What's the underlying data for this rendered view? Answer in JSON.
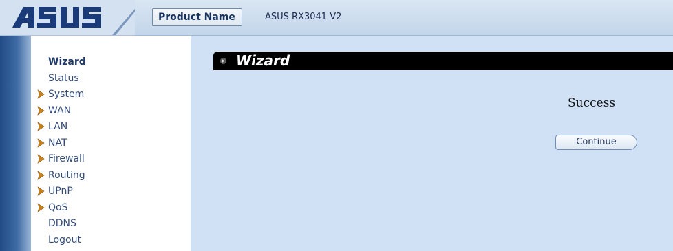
{
  "header": {
    "logo_text": "ASUS",
    "product_label": "Product Name",
    "product_value": "ASUS RX3041 V2"
  },
  "sidebar": {
    "items": [
      {
        "label": "Wizard",
        "active": true,
        "expandable": false
      },
      {
        "label": "Status",
        "active": false,
        "expandable": false
      },
      {
        "label": "System",
        "active": false,
        "expandable": true
      },
      {
        "label": "WAN",
        "active": false,
        "expandable": true
      },
      {
        "label": "LAN",
        "active": false,
        "expandable": true
      },
      {
        "label": "NAT",
        "active": false,
        "expandable": true
      },
      {
        "label": "Firewall",
        "active": false,
        "expandable": true
      },
      {
        "label": "Routing",
        "active": false,
        "expandable": true
      },
      {
        "label": "UPnP",
        "active": false,
        "expandable": true
      },
      {
        "label": "QoS",
        "active": false,
        "expandable": true
      },
      {
        "label": "DDNS",
        "active": false,
        "expandable": false
      },
      {
        "label": "Logout",
        "active": false,
        "expandable": false
      }
    ]
  },
  "main": {
    "title": "Wizard",
    "status_message": "Success",
    "continue_label": "Continue"
  },
  "colors": {
    "title_bar": "#000000",
    "content_background": "#d0e1f6",
    "menu_text": "#334d78",
    "expand_arrow": "#c8831c",
    "logo": "#1a3a7a"
  },
  "icons": {
    "expand": "expand-arrow-icon",
    "title_bullet": "bullet-arrow-icon"
  }
}
